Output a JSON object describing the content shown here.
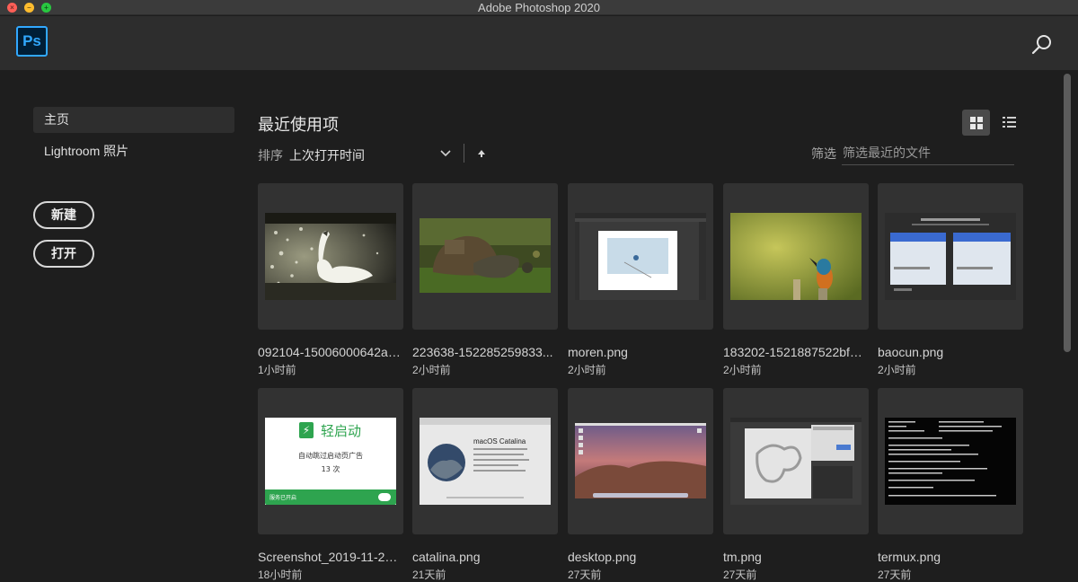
{
  "window": {
    "title": "Adobe Photoshop 2020"
  },
  "header": {
    "logo_text": "Ps",
    "search_icon": "search-icon"
  },
  "sidebar": {
    "items": [
      {
        "label": "主页",
        "active": true
      },
      {
        "label": "Lightroom 照片",
        "active": false
      }
    ],
    "new_label": "新建",
    "open_label": "打开"
  },
  "main": {
    "title": "最近使用项",
    "sort_label": "排序",
    "sort_value": "上次打开时间",
    "filter_label": "筛选",
    "filter_placeholder": "筛选最近的文件",
    "view_modes": [
      "grid-view-icon",
      "list-view-icon"
    ],
    "files": [
      {
        "name": "092104-15006000642ad...",
        "time": "1小时前",
        "thumb": "swan"
      },
      {
        "name": "223638-152285259833...",
        "time": "2小时前",
        "thumb": "tortoise"
      },
      {
        "name": "moren.png",
        "time": "2小时前",
        "thumb": "ps-moren"
      },
      {
        "name": "183202-1521887522bf1b...",
        "time": "2小时前",
        "thumb": "kingfisher"
      },
      {
        "name": "baocun.png",
        "time": "2小时前",
        "thumb": "baocun"
      },
      {
        "name": "Screenshot_2019-11-22-1...",
        "time": "18小时前",
        "thumb": "qidong",
        "thumb_text": {
          "app": "轻启动",
          "line1": "自动跳过启动页广告",
          "line2": "13 次",
          "footer": "服务已开启"
        }
      },
      {
        "name": "catalina.png",
        "time": "21天前",
        "thumb": "catalina",
        "thumb_text": {
          "os": "macOS Catalina"
        }
      },
      {
        "name": "desktop.png",
        "time": "27天前",
        "thumb": "desktop"
      },
      {
        "name": "tm.png",
        "time": "27天前",
        "thumb": "tm"
      },
      {
        "name": "termux.png",
        "time": "27天前",
        "thumb": "termux"
      }
    ]
  },
  "colors": {
    "ps_blue": "#31a8ff",
    "ps_dark": "#001e36",
    "background": "#1e1e1e",
    "card": "#323232",
    "header": "#2d2d2d"
  }
}
